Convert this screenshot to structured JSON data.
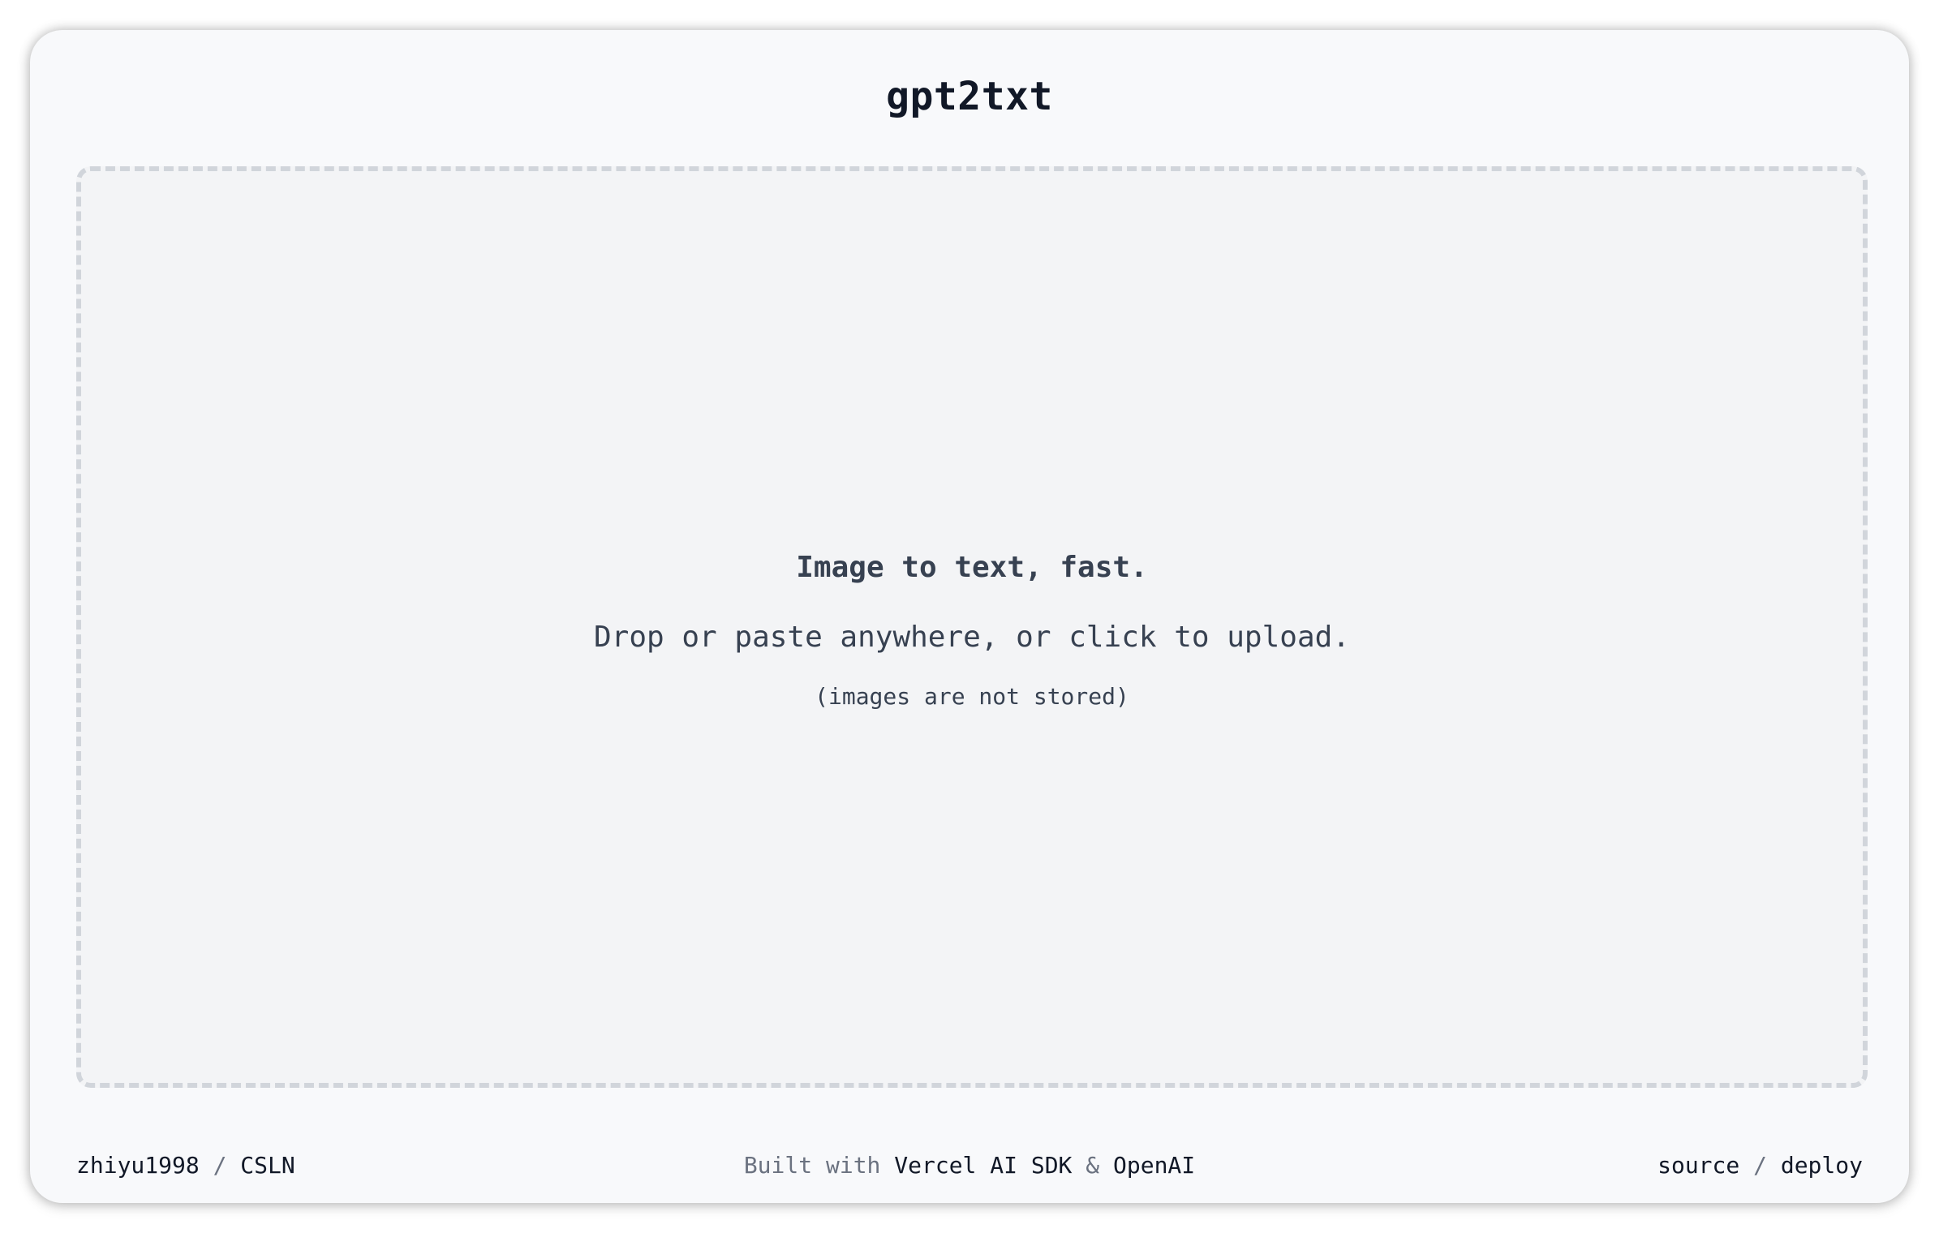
{
  "app": {
    "title": "gpt2txt"
  },
  "dropzone": {
    "headline": "Image to text, fast.",
    "instructions": "Drop or paste anywhere, or click to upload.",
    "note": "(images are not stored)"
  },
  "footer": {
    "left": {
      "author_link": "zhiyu1998",
      "separator": " / ",
      "org_link": "CSLN"
    },
    "center": {
      "prefix": "Built with ",
      "sdk_link": "Vercel AI SDK",
      "ampersand": " & ",
      "provider_link": "OpenAI"
    },
    "right": {
      "source_link": "source",
      "separator": " / ",
      "deploy_link": "deploy"
    }
  },
  "colors": {
    "page_background": "#f8f9fb",
    "dropzone_background": "#f3f4f6",
    "dropzone_border": "#d1d5db",
    "text_primary": "#111827",
    "text_secondary": "#374151",
    "text_muted": "#6b7280"
  }
}
